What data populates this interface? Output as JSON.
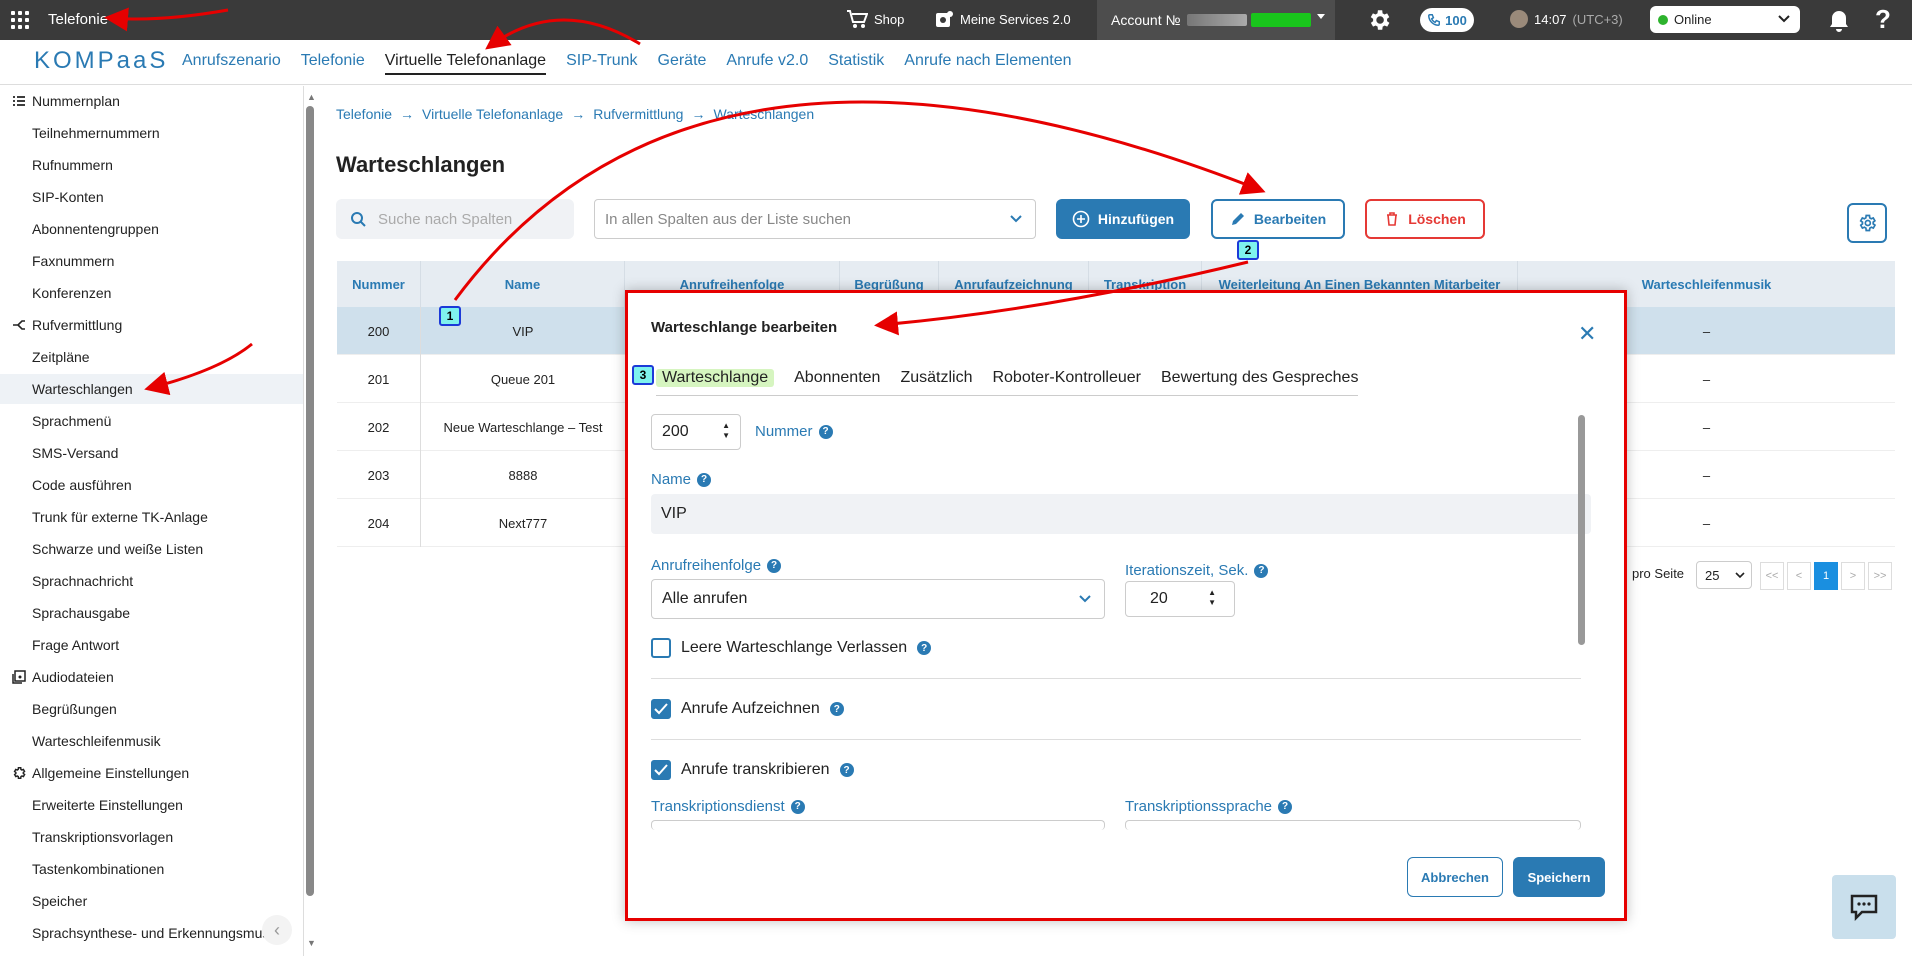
{
  "topbar": {
    "title": "Telefonie",
    "shop": "Shop",
    "services": "Meine Services 2.0",
    "account_label": "Account №",
    "calls_count": "100",
    "time": "14:07",
    "timezone": "(UTC+3)",
    "status": "Online",
    "help": "?"
  },
  "navbar": {
    "logo": "KOMPaaS",
    "tabs": [
      "Anrufszenario",
      "Telefonie",
      "Virtuelle Telefonanlage",
      "SIP-Trunk",
      "Geräte",
      "Anrufe v2.0",
      "Statistik",
      "Anrufe nach Elementen"
    ],
    "active_tab": "Virtuelle Telefonanlage"
  },
  "sidebar": {
    "items": [
      {
        "label": "Nummernplan",
        "type": "group",
        "icon": "list-icon"
      },
      {
        "label": "Teilnehmernummern",
        "type": "sub"
      },
      {
        "label": "Rufnummern",
        "type": "sub"
      },
      {
        "label": "SIP-Konten",
        "type": "sub"
      },
      {
        "label": "Abonnentengruppen",
        "type": "sub"
      },
      {
        "label": "Faxnummern",
        "type": "sub"
      },
      {
        "label": "Konferenzen",
        "type": "sub"
      },
      {
        "label": "Rufvermittlung",
        "type": "group",
        "icon": "routing-icon"
      },
      {
        "label": "Zeitpläne",
        "type": "sub"
      },
      {
        "label": "Warteschlangen",
        "type": "sub",
        "active": true
      },
      {
        "label": "Sprachmenü",
        "type": "sub"
      },
      {
        "label": "SMS-Versand",
        "type": "sub"
      },
      {
        "label": "Code ausführen",
        "type": "sub"
      },
      {
        "label": "Trunk für externe TK-Anlage",
        "type": "sub"
      },
      {
        "label": "Schwarze und weiße Listen",
        "type": "sub"
      },
      {
        "label": "Sprachnachricht",
        "type": "sub"
      },
      {
        "label": "Sprachausgabe",
        "type": "sub"
      },
      {
        "label": "Frage Antwort",
        "type": "sub"
      },
      {
        "label": "Audiodateien",
        "type": "group",
        "icon": "audio-icon"
      },
      {
        "label": "Begrüßungen",
        "type": "sub"
      },
      {
        "label": "Warteschleifenmusik",
        "type": "sub"
      },
      {
        "label": "Allgemeine Einstellungen",
        "type": "group",
        "icon": "gear-icon"
      },
      {
        "label": "Erweiterte Einstellungen",
        "type": "sub"
      },
      {
        "label": "Transkriptionsvorlagen",
        "type": "sub"
      },
      {
        "label": "Tastenkombinationen",
        "type": "sub"
      },
      {
        "label": "Speicher",
        "type": "sub"
      },
      {
        "label": "Sprachsynthese- und Erkennungsmus",
        "type": "sub"
      }
    ]
  },
  "breadcrumb": [
    "Telefonie",
    "Virtuelle Telefonanlage",
    "Rufvermittlung",
    "Warteschlangen"
  ],
  "page": {
    "title": "Warteschlangen",
    "column_search_placeholder": "Suche nach Spalten",
    "all_search_placeholder": "In allen Spalten aus der Liste suchen",
    "add_label": "Hinzufügen",
    "edit_label": "Bearbeiten",
    "delete_label": "Löschen"
  },
  "table": {
    "headers": [
      "Nummer",
      "Name",
      "Anrufreihenfolge",
      "Begrüßung",
      "Anrufaufzeichnung",
      "Transkription",
      "Weiterleitung An Einen Bekannten Mitarbeiter",
      "Warteschleifenmusik"
    ],
    "rows": [
      {
        "nummer": "200",
        "name": "VIP",
        "musik": "–",
        "selected": true
      },
      {
        "nummer": "201",
        "name": "Queue 201",
        "musik": "–"
      },
      {
        "nummer": "202",
        "name": "Neue Warteschlange – Test",
        "musik": "–"
      },
      {
        "nummer": "203",
        "name": "8888",
        "musik": "–"
      },
      {
        "nummer": "204",
        "name": "Next777",
        "musik": "–"
      }
    ]
  },
  "pagination": {
    "per_page_label": "pro Seite",
    "per_page": "25",
    "first": "<<",
    "prev": "<",
    "current": "1",
    "next": ">",
    "last": ">>"
  },
  "modal": {
    "title": "Warteschlange bearbeiten",
    "tabs": [
      "Warteschlange",
      "Abonnenten",
      "Zusätzlich",
      "Roboter-Kontrolleuer",
      "Bewertung des Gespreches"
    ],
    "active_tab": "Warteschlange",
    "number_value": "200",
    "number_label": "Nummer",
    "name_label": "Name",
    "name_value": "VIP",
    "order_label": "Anrufreihenfolge",
    "order_value": "Alle anrufen",
    "iteration_label": "Iterationszeit, Sek.",
    "iteration_value": "20",
    "leave_empty_label": "Leere Warteschlange Verlassen",
    "leave_empty_checked": false,
    "record_label": "Anrufe Aufzeichnen",
    "record_checked": true,
    "transcribe_label": "Anrufe transkribieren",
    "transcribe_checked": true,
    "transcription_service_label": "Transkriptionsdienst",
    "transcription_language_label": "Transkriptionssprache",
    "cancel_label": "Abbrechen",
    "save_label": "Speichern"
  },
  "annotations": {
    "badge1": "1",
    "badge2": "2",
    "badge3": "3",
    "arrow_color": "#e60000"
  }
}
